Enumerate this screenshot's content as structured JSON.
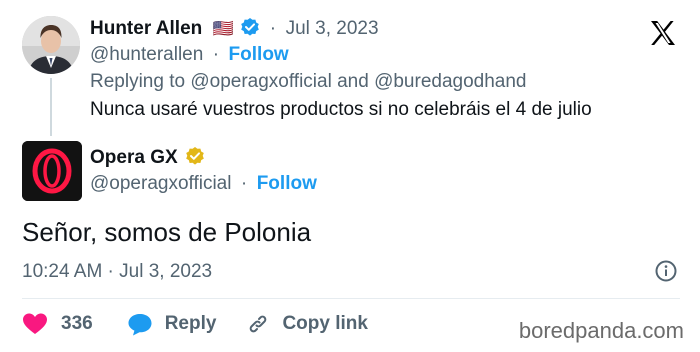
{
  "original_tweet": {
    "author_name": "Hunter Allen",
    "flag": "🇺🇸",
    "date": "Jul 3, 2023",
    "handle": "@hunterallen",
    "follow_label": "Follow",
    "replying_prefix": "Replying to",
    "replying_to_1": "@operagxofficial",
    "replying_and": "and",
    "replying_to_2": "@buredagodhand",
    "text": "Nunca usaré vuestros productos si no celebráis el 4 de julio"
  },
  "reply_tweet": {
    "author_name": "Opera GX",
    "handle": "@operagxofficial",
    "follow_label": "Follow",
    "text": "Señor, somos de Polonia",
    "timestamp": "10:24 AM · Jul 3, 2023"
  },
  "actions": {
    "like_count": "336",
    "reply_label": "Reply",
    "copy_link_label": "Copy link"
  },
  "watermark": "boredpanda.com",
  "colors": {
    "verified_blue": "#1d9bf0",
    "verified_gold": "#e2b719",
    "like_pink": "#f91880",
    "reply_blue": "#1d9bf0",
    "opera_red": "#ff1744"
  }
}
